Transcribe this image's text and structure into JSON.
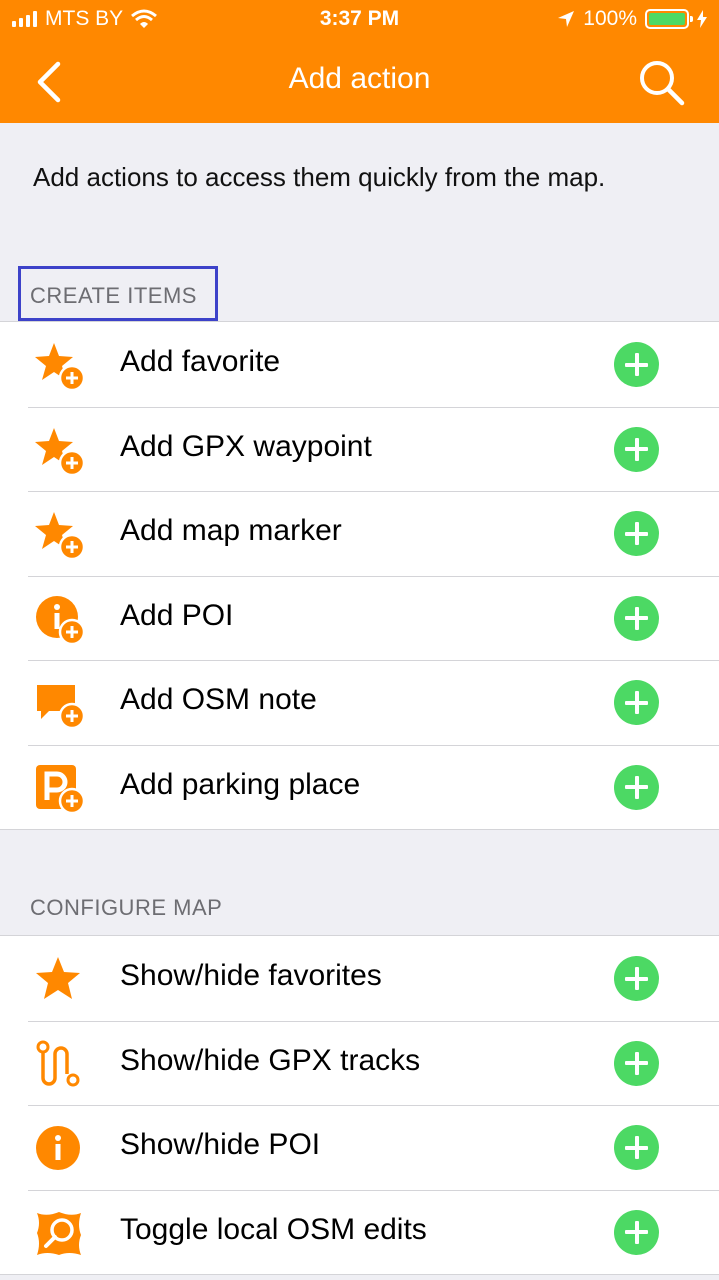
{
  "status_bar": {
    "carrier": "MTS BY",
    "time": "3:37 PM",
    "battery": "100%"
  },
  "nav": {
    "title": "Add action",
    "back_icon": "chevron-left-icon",
    "search_icon": "search-icon"
  },
  "description": "Add actions to access them quickly from the map.",
  "sections": [
    {
      "title": "CREATE ITEMS",
      "items": [
        {
          "label": "Add favorite",
          "icon": "star-plus-icon"
        },
        {
          "label": "Add GPX waypoint",
          "icon": "star-plus-icon"
        },
        {
          "label": "Add map marker",
          "icon": "star-plus-icon"
        },
        {
          "label": "Add POI",
          "icon": "info-plus-icon"
        },
        {
          "label": "Add OSM note",
          "icon": "note-plus-icon"
        },
        {
          "label": "Add parking place",
          "icon": "parking-plus-icon"
        }
      ]
    },
    {
      "title": "CONFIGURE MAP",
      "items": [
        {
          "label": "Show/hide favorites",
          "icon": "star-icon"
        },
        {
          "label": "Show/hide GPX tracks",
          "icon": "track-icon"
        },
        {
          "label": "Show/hide POI",
          "icon": "info-icon"
        },
        {
          "label": "Toggle local OSM edits",
          "icon": "osm-edits-icon"
        }
      ]
    }
  ],
  "colors": {
    "accent": "#ff8800",
    "add_button": "#4cd964",
    "background": "#efeff4",
    "highlight_box": "#3d42c9"
  }
}
